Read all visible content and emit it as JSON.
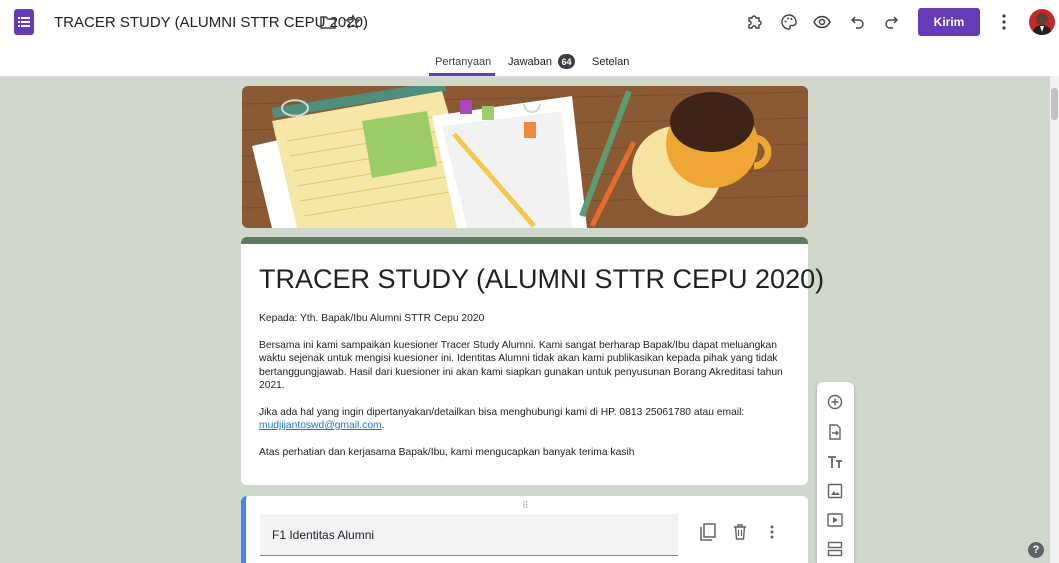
{
  "header": {
    "title": "TRACER STUDY (ALUMNI STTR CEPU 2020)",
    "send_label": "Kirim"
  },
  "tabs": [
    {
      "label": "Pertanyaan"
    },
    {
      "label": "Jawaban"
    },
    {
      "label": "Setelan"
    }
  ],
  "responses_count": "64",
  "form": {
    "title": "TRACER STUDY (ALUMNI STTR CEPU 2020)",
    "desc_to": "Kepada: Yth. Bapak/Ibu Alumni STTR Cepu 2020",
    "desc_p1": "Bersama ini kami sampaikan kuesioner Tracer Study Alumni. Kami sangat berharap Bapak/Ibu dapat meluangkan waktu sejenak untuk mengisi kuesioner ini. Identitas Alumni tidak akan kami publikasikan kepada pihak yang tidak bertanggungjawab. Hasil dari kuesioner ini akan kami siapkan gunakan untuk penyusunan Borang Akreditasi tahun 2021.",
    "desc_p2": "Jika ada hal yang ingin dipertanyakan/detailkan bisa menghubungi kami di HP. 0813 25061780  atau email:",
    "email": "mudjijantoswd@gmail.com",
    "desc_p2_end": ".",
    "desc_p3": "Atas perhatian dan kerjasama Bapak/Ibu, kami mengucapkan banyak terima kasih"
  },
  "section": {
    "title": "F1 Identitas Alumni"
  },
  "icons": [
    "forms-app-icon",
    "folder-icon",
    "star-icon",
    "addon-icon",
    "palette-icon",
    "preview-eye-icon",
    "undo-icon",
    "redo-icon",
    "more-vert-icon",
    "add-question-icon",
    "import-questions-icon",
    "add-title-icon",
    "add-image-icon",
    "add-video-icon",
    "add-section-icon",
    "duplicate-icon",
    "delete-icon",
    "help-icon"
  ],
  "colors": {
    "accent": "#673ab7",
    "background": "#d0d8cc",
    "header_bar": "#5e7a5c",
    "section_border": "#4285f4"
  }
}
